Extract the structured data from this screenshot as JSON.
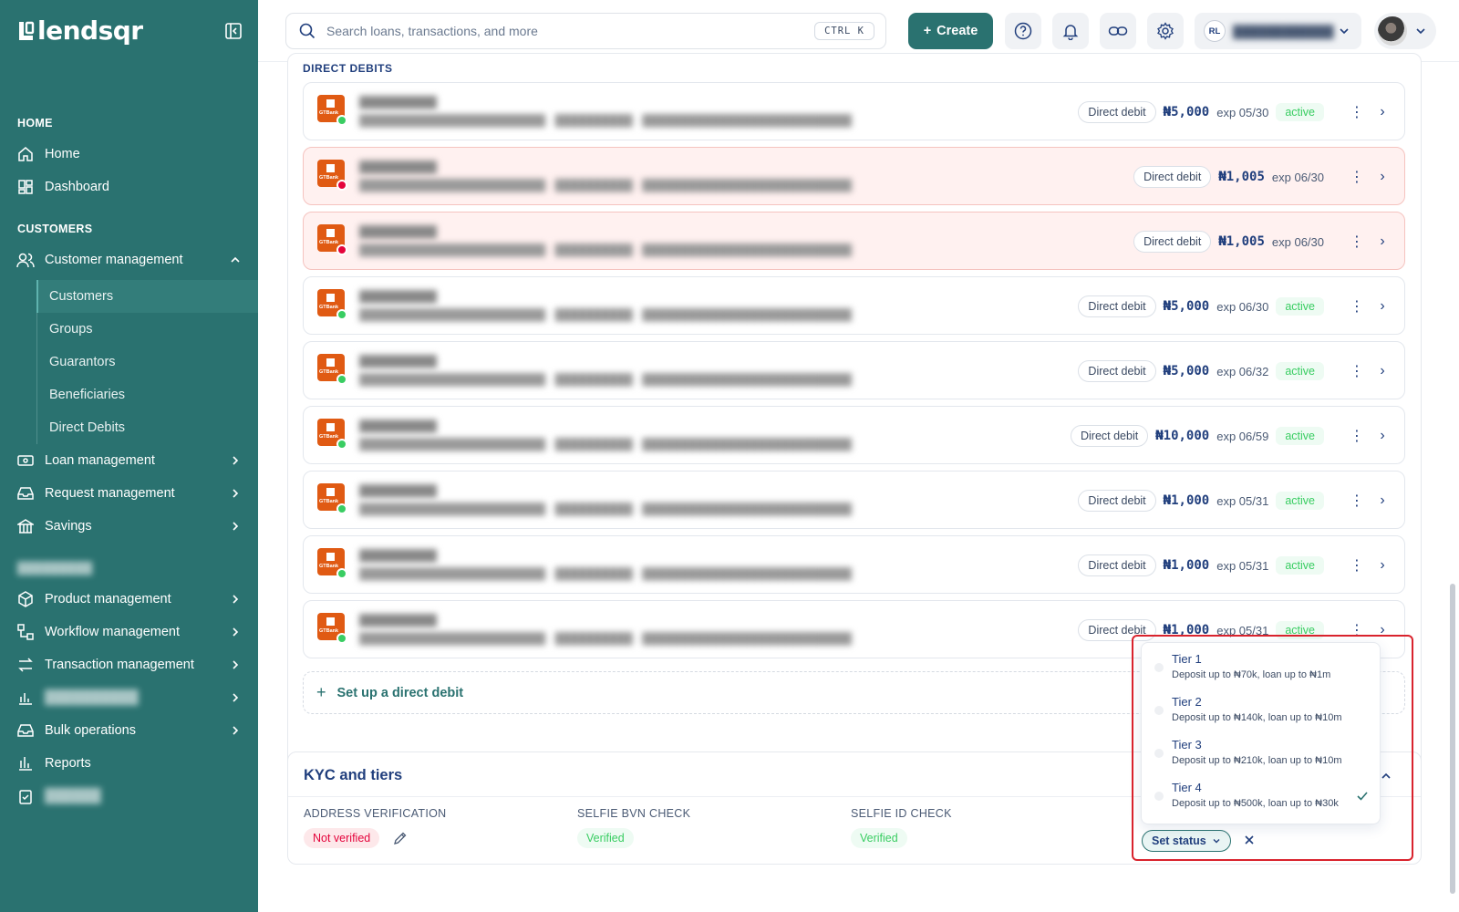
{
  "brand": {
    "name": "lendsqr",
    "primary": "#2a7270",
    "success": "#39cd62",
    "danger": "#e4033b"
  },
  "sidebar": {
    "sections": {
      "home": "HOME",
      "customers": "CUSTOMERS"
    },
    "home_items": [
      {
        "label": "Home",
        "icon": "home-icon"
      },
      {
        "label": "Dashboard",
        "icon": "dashboard-icon"
      }
    ],
    "customer_management": {
      "label": "Customer management",
      "icon": "users-icon",
      "expanded": true
    },
    "customer_sub": [
      "Customers",
      "Groups",
      "Guarantors",
      "Beneficiaries",
      "Direct Debits"
    ],
    "active_sub": "Customers",
    "lower_items": [
      {
        "label": "Loan management",
        "icon": "loan-icon"
      },
      {
        "label": "Request management",
        "icon": "inbox-icon"
      },
      {
        "label": "Savings",
        "icon": "bank-icon"
      },
      {
        "label": "Product management",
        "icon": "box-icon"
      },
      {
        "label": "Workflow management",
        "icon": "workflow-icon"
      },
      {
        "label": "Transaction management",
        "icon": "swap-icon"
      },
      {
        "label": "Bulk operations",
        "icon": "inbox-icon"
      },
      {
        "label": "Reports",
        "icon": "bar-chart-icon"
      }
    ]
  },
  "topbar": {
    "search_placeholder": "Search loans, transactions, and more",
    "shortcut": "CTRL K",
    "create_label": "Create",
    "org_initials": "RL"
  },
  "direct_debits": {
    "title": "DIRECT DEBITS",
    "rows": [
      {
        "badge": "Direct debit",
        "amount": "₦5,000",
        "exp": "exp 05/30",
        "status": "active",
        "dot": "#39cd62",
        "warn": false
      },
      {
        "badge": "Direct debit",
        "amount": "₦1,005",
        "exp": "exp 06/30",
        "status": "",
        "dot": "#e4033b",
        "warn": true
      },
      {
        "badge": "Direct debit",
        "amount": "₦1,005",
        "exp": "exp 06/30",
        "status": "",
        "dot": "#e4033b",
        "warn": true
      },
      {
        "badge": "Direct debit",
        "amount": "₦5,000",
        "exp": "exp 06/30",
        "status": "active",
        "dot": "#39cd62",
        "warn": false
      },
      {
        "badge": "Direct debit",
        "amount": "₦5,000",
        "exp": "exp 06/32",
        "status": "active",
        "dot": "#39cd62",
        "warn": false
      },
      {
        "badge": "Direct debit",
        "amount": "₦10,000",
        "exp": "exp 06/59",
        "status": "active",
        "dot": "#39cd62",
        "warn": false
      },
      {
        "badge": "Direct debit",
        "amount": "₦1,000",
        "exp": "exp 05/31",
        "status": "active",
        "dot": "#39cd62",
        "warn": false
      },
      {
        "badge": "Direct debit",
        "amount": "₦1,000",
        "exp": "exp 05/31",
        "status": "active",
        "dot": "#39cd62",
        "warn": false
      },
      {
        "badge": "Direct debit",
        "amount": "₦1,000",
        "exp": "exp 05/31",
        "status": "active",
        "dot": "#39cd62",
        "warn": false
      }
    ],
    "setup_label": "Set up a direct debit"
  },
  "kyc": {
    "title": "KYC and tiers",
    "address": {
      "label": "ADDRESS VERIFICATION",
      "status": "Not verified"
    },
    "selfie_bvn": {
      "label": "SELFIE BVN CHECK",
      "status": "Verified"
    },
    "selfie_id": {
      "label": "SELFIE ID CHECK",
      "status": "Verified"
    },
    "set_status_label": "Set status"
  },
  "tier_menu": {
    "options": [
      {
        "name": "Tier 1",
        "desc": "Deposit up to ₦70k, loan up to ₦1m",
        "selected": false
      },
      {
        "name": "Tier 2",
        "desc": "Deposit up to ₦140k, loan up to ₦10m",
        "selected": false
      },
      {
        "name": "Tier 3",
        "desc": "Deposit up to ₦210k, loan up to ₦10m",
        "selected": false
      },
      {
        "name": "Tier 4",
        "desc": "Deposit up to ₦500k, loan up to ₦30k",
        "selected": true
      }
    ]
  }
}
